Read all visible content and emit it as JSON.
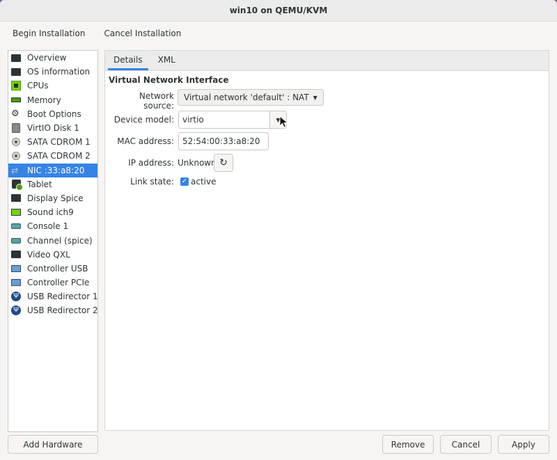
{
  "window": {
    "title": "win10 on QEMU/KVM"
  },
  "toolbar": {
    "begin_label": "Begin Installation",
    "cancel_label": "Cancel Installation"
  },
  "sidebar": {
    "items": [
      {
        "label": "Overview",
        "icon": "monitor-icon"
      },
      {
        "label": "OS information",
        "icon": "monitor-icon"
      },
      {
        "label": "CPUs",
        "icon": "cpu-icon"
      },
      {
        "label": "Memory",
        "icon": "memory-icon"
      },
      {
        "label": "Boot Options",
        "icon": "gear-icon"
      },
      {
        "label": "VirtIO Disk 1",
        "icon": "disk-icon"
      },
      {
        "label": "SATA CDROM 1",
        "icon": "cdrom-icon"
      },
      {
        "label": "SATA CDROM 2",
        "icon": "cdrom-icon"
      },
      {
        "label": "NIC :33:a8:20",
        "icon": "network-icon",
        "selected": true
      },
      {
        "label": "Tablet",
        "icon": "tablet-icon"
      },
      {
        "label": "Display Spice",
        "icon": "monitor-icon"
      },
      {
        "label": "Sound ich9",
        "icon": "sound-card-icon"
      },
      {
        "label": "Console 1",
        "icon": "serial-icon"
      },
      {
        "label": "Channel (spice)",
        "icon": "serial-icon"
      },
      {
        "label": "Video QXL",
        "icon": "monitor-icon"
      },
      {
        "label": "Controller USB",
        "icon": "controller-icon"
      },
      {
        "label": "Controller PCIe",
        "icon": "controller-icon"
      },
      {
        "label": "USB Redirector 1",
        "icon": "usb-icon"
      },
      {
        "label": "USB Redirector 2",
        "icon": "usb-icon"
      }
    ]
  },
  "tabs": [
    {
      "label": "Details",
      "active": true
    },
    {
      "label": "XML",
      "active": false
    }
  ],
  "details": {
    "section_title": "Virtual Network Interface",
    "network_source_label": "Network source:",
    "network_source_value": "Virtual network 'default' : NAT",
    "device_model_label": "Device model:",
    "device_model_value": "virtio",
    "mac_label": "MAC address:",
    "mac_value": "52:54:00:33:a8:20",
    "ip_label": "IP address:",
    "ip_value": "Unknown",
    "link_label": "Link state:",
    "link_value": "active",
    "link_checked": true
  },
  "bottom": {
    "add_hardware": "Add Hardware",
    "remove": "Remove",
    "cancel": "Cancel",
    "apply": "Apply"
  },
  "colors": {
    "accent": "#3584e4",
    "window_bg": "#f6f5f4",
    "desktop_bg": "#7a5e8c"
  }
}
